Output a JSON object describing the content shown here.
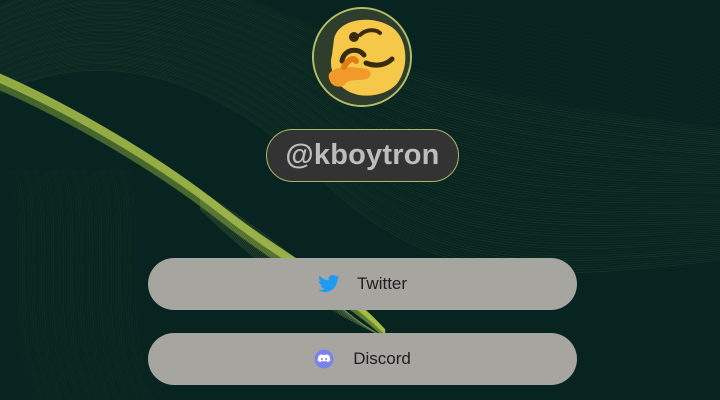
{
  "profile": {
    "avatar_icon": "thinking-blob-emoji-icon",
    "handle": "@kboytron"
  },
  "links": [
    {
      "label": "Twitter",
      "icon": "twitter-bird-icon",
      "icon_color": "#1d9bf0"
    },
    {
      "label": "Discord",
      "icon": "discord-icon",
      "icon_color": "#7a82f0"
    }
  ],
  "colors": {
    "background": "#072420",
    "accent_green": "#a9c04a",
    "button_bg": "#a6a59f",
    "handle_bg": "#333333"
  }
}
